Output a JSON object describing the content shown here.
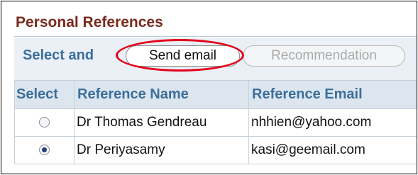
{
  "section": {
    "title": "Personal References"
  },
  "toolbar": {
    "prefix_text": "Select and",
    "send_email_label": "Send email",
    "recommendation_label": "Recommendation",
    "recommendation_enabled": false
  },
  "table": {
    "headers": [
      "Select",
      "Reference Name",
      "Reference Email"
    ],
    "rows": [
      {
        "selected": false,
        "name": "Dr Thomas Gendreau",
        "email": "nhhien@yahoo.com"
      },
      {
        "selected": true,
        "name": "Dr Periyasamy",
        "email": "kasi@geemail.com"
      }
    ]
  },
  "annotation": {
    "highlight_color": "#e3001b",
    "highlight_target": "send-email-button"
  }
}
